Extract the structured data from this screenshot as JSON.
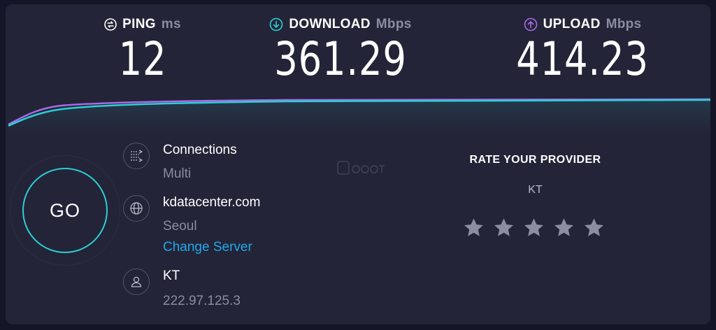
{
  "ping": {
    "label": "PING",
    "unit": "ms",
    "value": "12",
    "icon": "ping-icon"
  },
  "download": {
    "label": "DOWNLOAD",
    "unit": "Mbps",
    "value": "361.29",
    "icon": "download-arrow-icon",
    "color": "#2ccfd6"
  },
  "upload": {
    "label": "UPLOAD",
    "unit": "Mbps",
    "value": "414.23",
    "icon": "upload-arrow-icon",
    "color": "#a86bea"
  },
  "go_button": {
    "label": "GO",
    "color": "#2ccfd6"
  },
  "connections": {
    "title": "Connections",
    "mode": "Multi",
    "icon": "connections-icon"
  },
  "server": {
    "host": "kdatacenter.com",
    "location": "Seoul",
    "change_label": "Change Server",
    "icon": "globe-icon"
  },
  "provider": {
    "name": "KT",
    "ip": "222.97.125.3",
    "icon": "user-icon"
  },
  "rating": {
    "title": "RATE YOUR PROVIDER",
    "provider": "KT",
    "stars": 5,
    "selected": 0
  },
  "colors": {
    "background": "#141526",
    "panel": "#232437",
    "link": "#1fa9ee",
    "muted": "#8b8ca0"
  }
}
